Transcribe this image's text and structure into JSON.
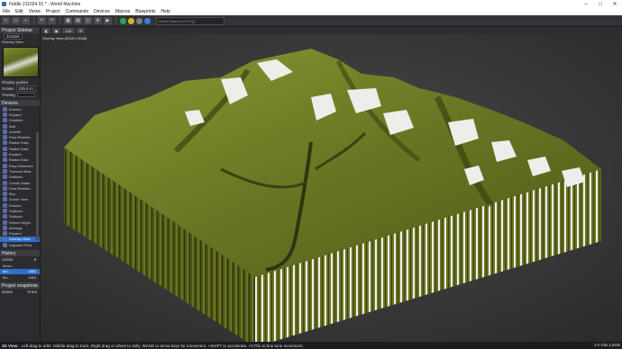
{
  "window": {
    "title": "Fiddle 211024 01 * - World Machine",
    "minimize": "–",
    "maximize": "□",
    "close": "✕"
  },
  "menu": [
    "File",
    "Edit",
    "Views",
    "Project",
    "Commands",
    "Devices",
    "Macros",
    "Blueprints",
    "Help"
  ],
  "toolbar": {
    "search_placeholder": "Action Search (Ctrl+Q)"
  },
  "sidebar": {
    "title": "Project Sidebar",
    "project_name": "211024",
    "overlay_label": "Overlay View",
    "display_guides": "Display guides",
    "scales_label": "Scales",
    "scales_value": "236.6 m",
    "tracing_label": "Tracing",
    "devices_title": "Devices",
    "devices": [
      "Erosion",
      "Expand",
      "Gradient",
      "Add",
      "Inverter",
      "Flow Restrict...",
      "Radial Grad.",
      "Radial Grad.",
      "Expand",
      "Radial Grad.",
      "Easy Distortion",
      "Thermal Wea...",
      "Subtract",
      "Create Water",
      "Flow Restrict...",
      "Blur",
      "Scene View",
      "Erosion",
      "Subtract",
      "Subtract",
      "Select Height",
      "Average",
      "Expand",
      "Overlay View",
      "Adjusted Flow"
    ],
    "selected_device": "Overlay View",
    "history_title": "History",
    "history_header": "Action",
    "history_items": [
      "Move...",
      "Mo...",
      "Mo..."
    ],
    "history_values": [
      "",
      "1683",
      "1683"
    ],
    "snapshots_title": "Project snapshots",
    "snap_name": "Name",
    "snap_from": "From"
  },
  "viewport": {
    "label": "Overlay View (2048 x 2048)",
    "tab_ab": "A B"
  },
  "status": {
    "mode": "3D View:",
    "hint": "Left drag to orbit. Middle drag to track. Right drag or wheel to dolly. WASD or arrow keys for movement. +SHIFT to accelerate, +CTRL to fine tune movement.",
    "memory": "3.0 GiB 4.8GB"
  },
  "colors": {
    "selected": "#2d6fd1",
    "terrain": "#6b7a24",
    "snow": "#e9ece7"
  }
}
